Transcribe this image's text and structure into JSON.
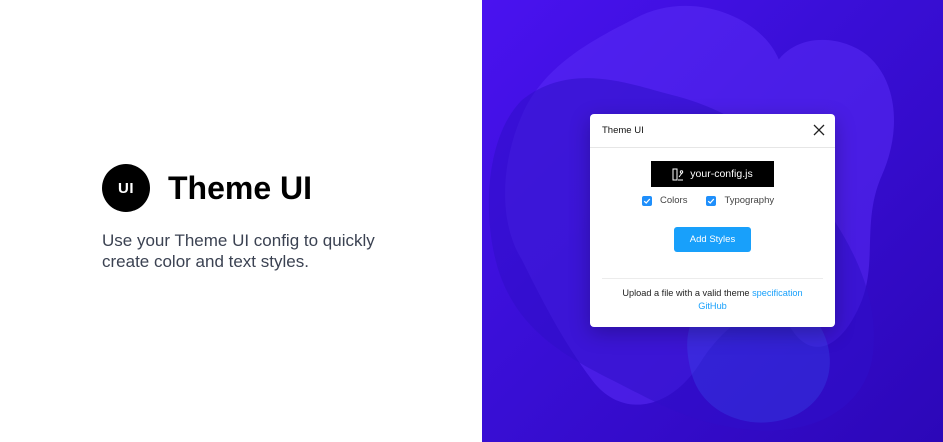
{
  "brand": {
    "logo_text": "UI",
    "title": "Theme UI",
    "tagline": "Use your Theme UI config to quickly create color and text styles."
  },
  "background": {
    "gradient_start": "#4a12f0",
    "gradient_end": "#2c07b8"
  },
  "dialog": {
    "title": "Theme UI",
    "close_icon": "close-icon",
    "file_button": {
      "icon": "file-icon",
      "label": "your-config.js"
    },
    "checkboxes": [
      {
        "label": "Colors",
        "checked": true
      },
      {
        "label": "Typography",
        "checked": true
      }
    ],
    "add_button_label": "Add Styles",
    "footer": {
      "text": "Upload a file with a valid theme",
      "link_spec": "specification",
      "link_github": "GitHub"
    }
  },
  "colors": {
    "accent": "#18a0fb",
    "checkbox": "#1f8ffb",
    "button_dark": "#000000"
  }
}
